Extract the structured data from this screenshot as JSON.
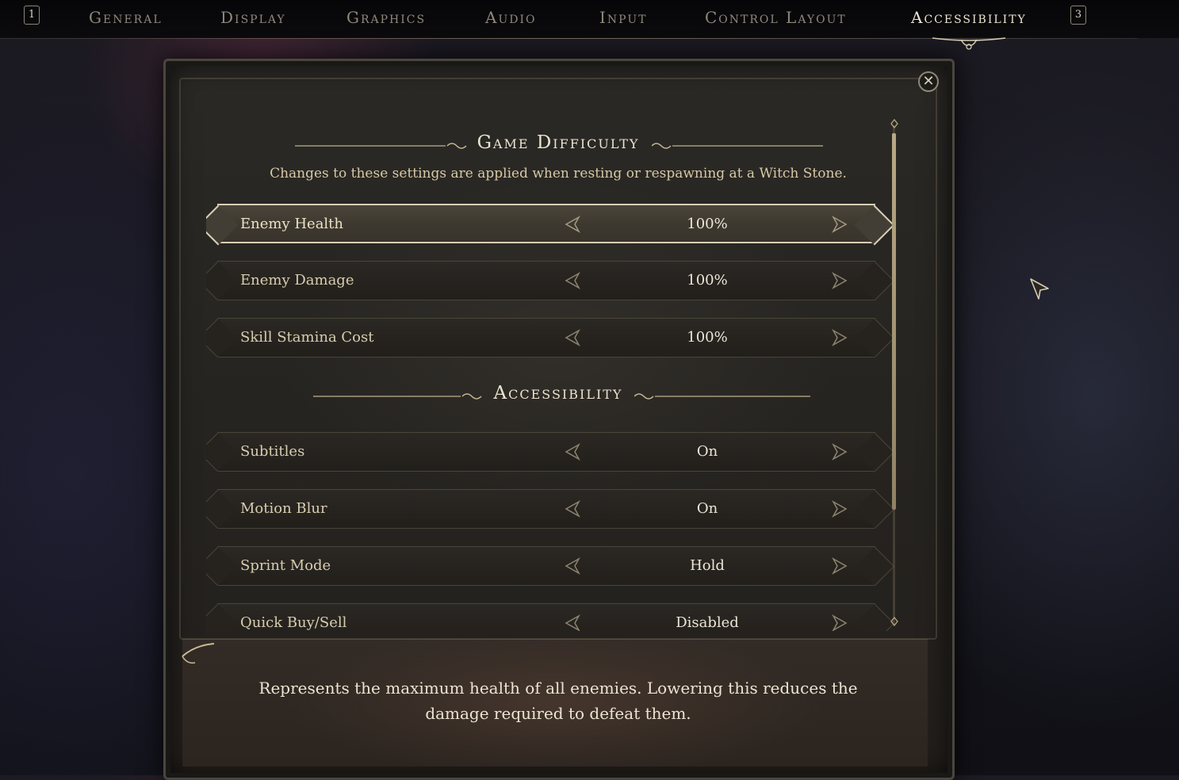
{
  "tabs": {
    "prev_key": "1",
    "next_key": "3",
    "items": [
      {
        "label": "General",
        "active": false
      },
      {
        "label": "Display",
        "active": false
      },
      {
        "label": "Graphics",
        "active": false
      },
      {
        "label": "Audio",
        "active": false
      },
      {
        "label": "Input",
        "active": false
      },
      {
        "label": "Control Layout",
        "active": false
      },
      {
        "label": "Accessibility",
        "active": true
      }
    ]
  },
  "panel": {
    "close_icon": "close-icon",
    "sections": {
      "difficulty": {
        "title": "Game Difficulty",
        "subtitle": "Changes to these settings are applied when resting or respawning at a Witch Stone."
      },
      "accessibility": {
        "title": "Accessibility"
      }
    },
    "rows": [
      {
        "label": "Enemy Health",
        "value": "100%",
        "selected": true
      },
      {
        "label": "Enemy Damage",
        "value": "100%",
        "selected": false
      },
      {
        "label": "Skill Stamina Cost",
        "value": "100%",
        "selected": false
      },
      {
        "label": "Subtitles",
        "value": "On",
        "selected": false
      },
      {
        "label": "Motion Blur",
        "value": "On",
        "selected": false
      },
      {
        "label": "Sprint Mode",
        "value": "Hold",
        "selected": false
      },
      {
        "label": "Quick Buy/Sell",
        "value": "Disabled",
        "selected": false
      }
    ],
    "description": "Represents the maximum health of all enemies. Lowering this reduces the damage required to defeat them."
  },
  "colors": {
    "accent_gold": "#d8cfb5",
    "text_active": "#ece4d0",
    "text_inactive": "#8f887a"
  }
}
